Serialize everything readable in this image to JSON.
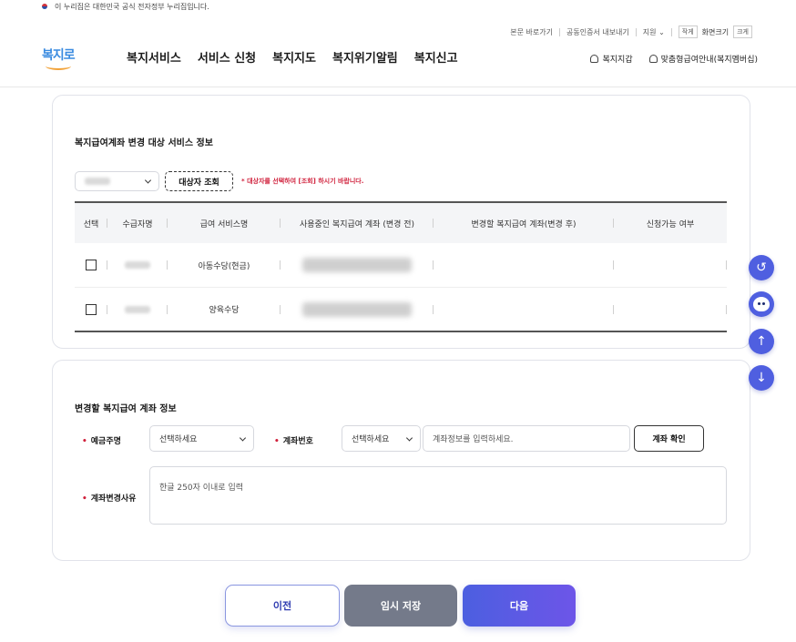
{
  "gov_banner": {
    "text": "이 누리집은 대한민국 공식 전자정부 누리집입니다."
  },
  "util_nav": {
    "skip": "본문 바로가기",
    "cert": "공동인증서 내보내기",
    "support": "지원",
    "font_small": "작게",
    "font_label": "화면크기",
    "font_large": "크게"
  },
  "logo": {
    "text": "복지로"
  },
  "gnb": [
    "복지서비스",
    "서비스 신청",
    "복지지도",
    "복지위기알림",
    "복지신고"
  ],
  "member_links": {
    "wallet": "복지지갑",
    "guide": "맞춤형급여안내(복지멤버십)"
  },
  "section1": {
    "title": "복지급여계좌 변경 대상 서비스 정보",
    "lookup_button": "대상자 조회",
    "notice": "* 대상자를 선택하여 [조회] 하시기 바랍니다.",
    "table": {
      "headers": [
        "선택",
        "수급자명",
        "급여 서비스명",
        "사용중인 복지급여 계좌 (변경 전)",
        "변경할 복지급여 계좌(변경 후)",
        "신청가능 여부"
      ],
      "rows": [
        {
          "service": "아동수당(현금)"
        },
        {
          "service": "양육수당"
        }
      ]
    }
  },
  "section2": {
    "title": "변경할 복지급여 계좌 정보",
    "holder_label": "예금주명",
    "holder_select": "선택하세요",
    "account_label": "계좌번호",
    "bank_select": "선택하세요",
    "account_placeholder": "계좌정보를 입력하세요.",
    "verify_button": "계좌 확인",
    "reason_label": "계좌변경사유",
    "reason_placeholder": "한글 250자 이내로 입력"
  },
  "bottom": {
    "prev": "이전",
    "save": "임시 저장",
    "next": "다음"
  },
  "colors": {
    "accent": "#4f5fe0",
    "required": "#d0213c"
  }
}
